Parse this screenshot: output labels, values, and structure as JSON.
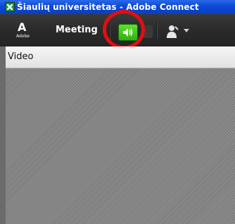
{
  "window": {
    "title": "Šiaulių universitetas - Adobe Connect"
  },
  "toolbar": {
    "logo_mark": "A",
    "logo_text": "Adobe",
    "menu_meeting": "Meeting",
    "speaker_icon": "speaker-icon",
    "user_icon": "attendee-icon",
    "speaker_active_color": "#3fc81e"
  },
  "annotation": {
    "ring_color": "#e01010"
  },
  "pod": {
    "title": "Video"
  }
}
